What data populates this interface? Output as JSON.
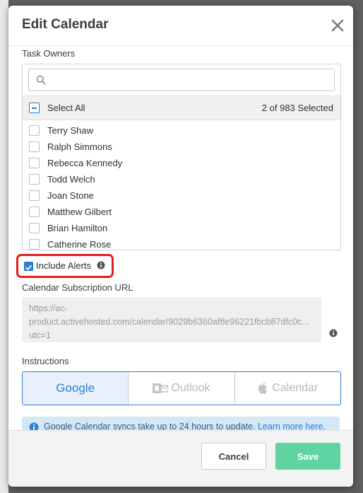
{
  "modal": {
    "title": "Edit Calendar",
    "close_icon": "close-icon"
  },
  "task_owners": {
    "label": "Task Owners",
    "search_placeholder": "",
    "select_all_label": "Select All",
    "selected_count": "2 of 983 Selected",
    "owners": [
      {
        "name": "Terry Shaw"
      },
      {
        "name": "Ralph Simmons"
      },
      {
        "name": "Rebecca Kennedy"
      },
      {
        "name": "Todd Welch"
      },
      {
        "name": "Joan Stone"
      },
      {
        "name": "Matthew Gilbert"
      },
      {
        "name": "Brian Hamilton"
      },
      {
        "name": "Catherine Rose"
      }
    ]
  },
  "alerts": {
    "label": "Include Alerts",
    "checked": true
  },
  "subscription": {
    "label": "Calendar Subscription URL",
    "url_lines": [
      "https://ac-",
      "product.activehosted.com/calendar/9029b6360af8e96221fbcb87dfc0c...",
      "utc=1"
    ]
  },
  "instructions": {
    "label": "Instructions",
    "tabs": [
      {
        "label": "Google",
        "selected": true
      },
      {
        "label": "Outlook",
        "selected": false
      },
      {
        "label": "Calendar",
        "selected": false
      }
    ],
    "notice_text": "Google Calendar syncs take up to 24 hours to update.",
    "notice_link": "Learn more here."
  },
  "footer": {
    "cancel_label": "Cancel",
    "save_label": "Save"
  },
  "colors": {
    "accent": "#2f7fd4",
    "save": "#5fd3a0",
    "highlight": "#e02020"
  }
}
